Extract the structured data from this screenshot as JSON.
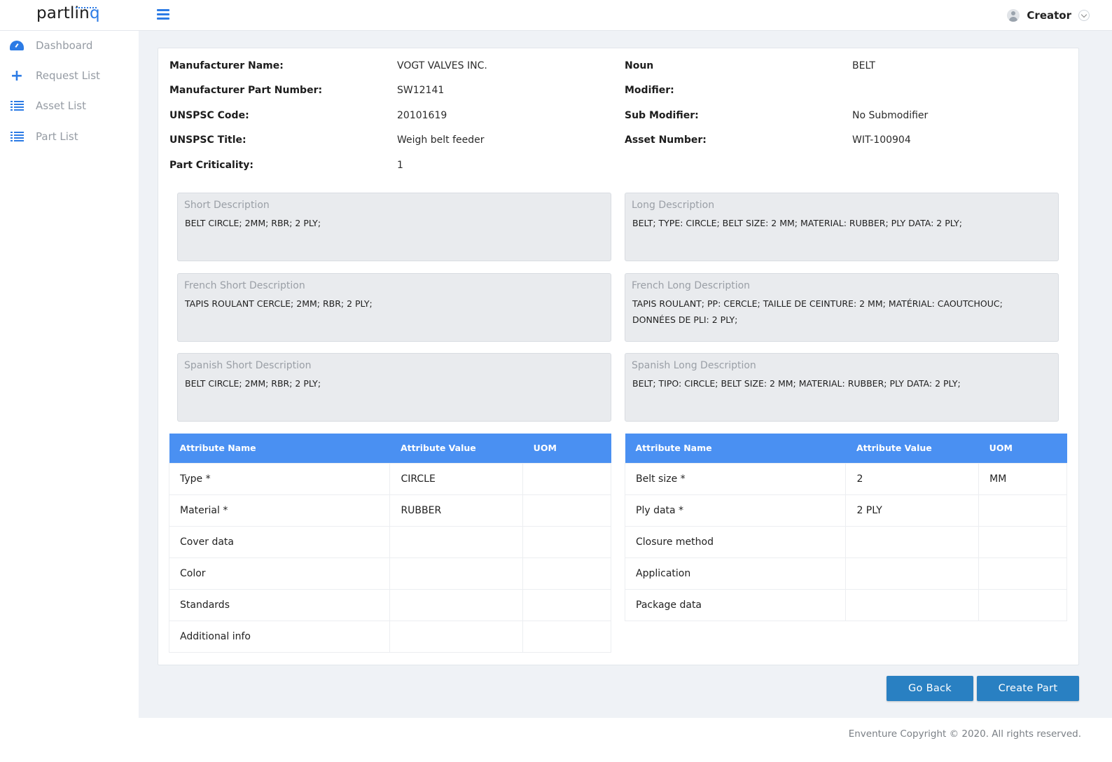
{
  "app": {
    "logo_text_main": "partlin",
    "logo_text_accent": "q",
    "user_name": "Creator"
  },
  "sidebar": {
    "items": [
      {
        "label": "Dashboard",
        "icon": "dashboard-icon"
      },
      {
        "label": "Request List",
        "icon": "plus-icon"
      },
      {
        "label": "Asset List",
        "icon": "list-icon"
      },
      {
        "label": "Part List",
        "icon": "list-icon"
      }
    ]
  },
  "details": {
    "left": [
      {
        "label": "Manufacturer Name:",
        "value": "VOGT VALVES INC."
      },
      {
        "label": "Manufacturer Part Number:",
        "value": "SW12141"
      },
      {
        "label": "UNSPSC Code:",
        "value": "20101619"
      },
      {
        "label": "UNSPSC Title:",
        "value": "Weigh belt feeder"
      },
      {
        "label": "Part Criticality:",
        "value": "1"
      }
    ],
    "right": [
      {
        "label": "Noun",
        "value": "BELT"
      },
      {
        "label": "Modifier:",
        "value": ""
      },
      {
        "label": "Sub Modifier:",
        "value": "No Submodifier"
      },
      {
        "label": "Asset Number:",
        "value": "WIT-100904"
      }
    ]
  },
  "descriptions": {
    "short": {
      "title": "Short Description",
      "text": "BELT CIRCLE; 2MM; RBR; 2 PLY;"
    },
    "long": {
      "title": "Long Description",
      "text": "BELT; TYPE: CIRCLE; BELT SIZE: 2 MM; MATERIAL: RUBBER; PLY DATA: 2 PLY;"
    },
    "french_short": {
      "title": "French Short Description",
      "text": "TAPIS ROULANT CERCLE; 2MM; RBR; 2 PLY;"
    },
    "french_long": {
      "title": "French Long Description",
      "text": "TAPIS ROULANT; PP: CERCLE; TAILLE DE CEINTURE: 2 MM; MATÉRIAL: CAOUTCHOUC; DONNÉES DE PLI: 2 PLY;"
    },
    "spanish_short": {
      "title": "Spanish Short Description",
      "text": "BELT CIRCLE; 2MM; RBR; 2 PLY;"
    },
    "spanish_long": {
      "title": "Spanish Long Description",
      "text": "BELT; TIPO: CIRCLE; BELT SIZE: 2 MM; MATERIAL: RUBBER; PLY DATA: 2 PLY;"
    }
  },
  "attributes": {
    "headers": [
      "Attribute Name",
      "Attribute Value",
      "UOM"
    ],
    "left_rows": [
      [
        "Type *",
        "CIRCLE",
        ""
      ],
      [
        "Material *",
        "RUBBER",
        ""
      ],
      [
        "Cover data",
        "",
        ""
      ],
      [
        "Color",
        "",
        ""
      ],
      [
        "Standards",
        "",
        ""
      ],
      [
        "Additional info",
        "",
        ""
      ]
    ],
    "right_rows": [
      [
        "Belt size *",
        "2",
        "MM"
      ],
      [
        "Ply data *",
        "2 PLY",
        ""
      ],
      [
        "Closure method",
        "",
        ""
      ],
      [
        "Application",
        "",
        ""
      ],
      [
        "Package data",
        "",
        ""
      ]
    ]
  },
  "actions": {
    "go_back": "Go Back",
    "create_part": "Create Part"
  },
  "footer": {
    "copyright": "Enventure Copyright © 2020. All rights reserved."
  },
  "colors": {
    "accent": "#2c7be5",
    "table_header": "#4a90f2",
    "button": "#2980c2",
    "main_bg": "#eff2f6"
  }
}
